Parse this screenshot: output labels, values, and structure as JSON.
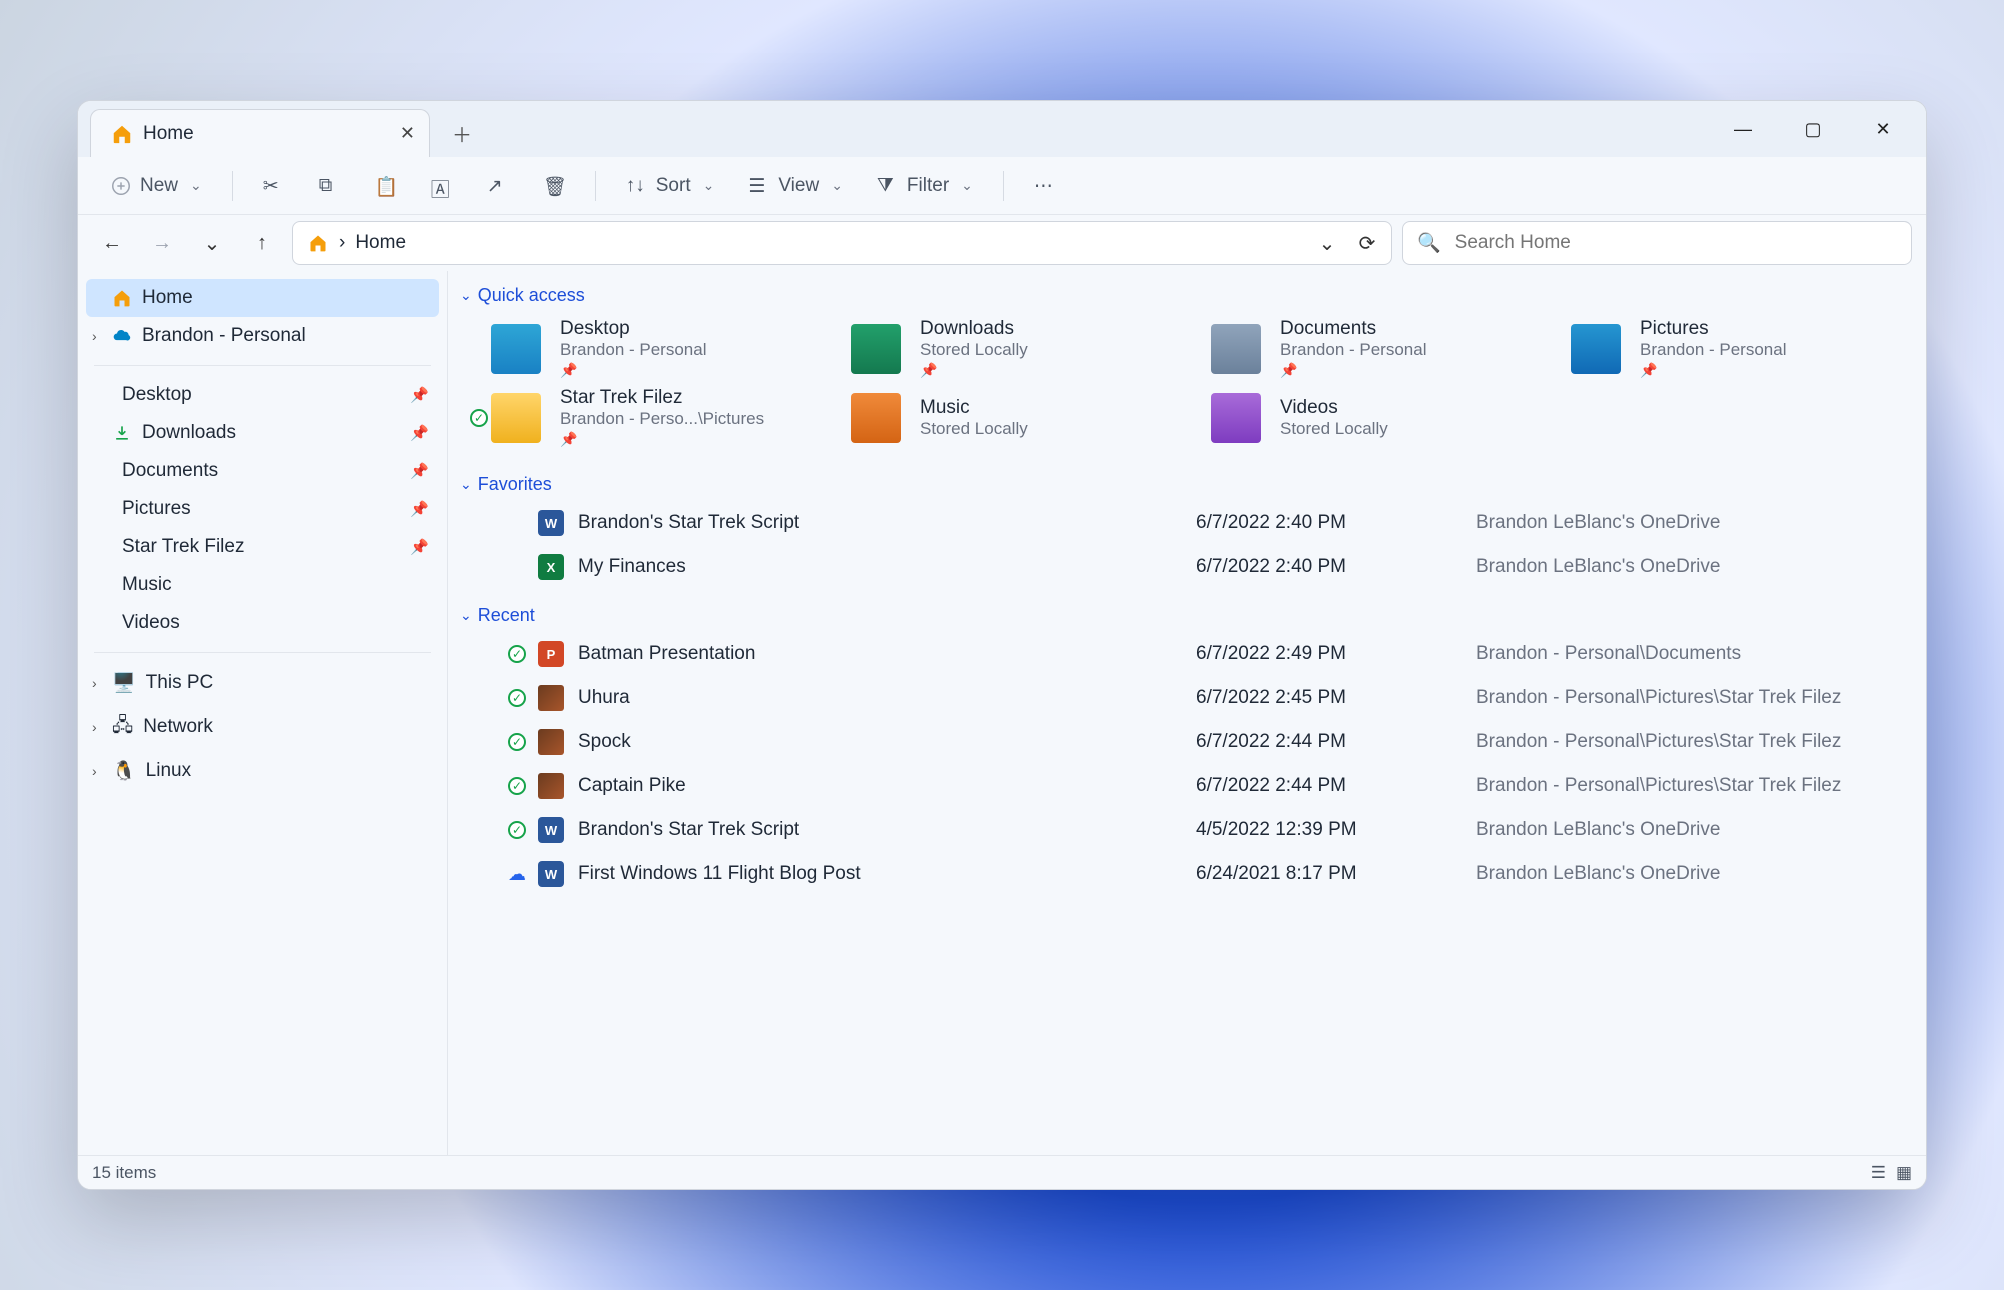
{
  "tab": {
    "title": "Home"
  },
  "toolbar": {
    "new": "New",
    "sort": "Sort",
    "view": "View",
    "filter": "Filter"
  },
  "address": {
    "path": "Home",
    "separator": "›"
  },
  "search": {
    "placeholder": "Search Home"
  },
  "sidebar": {
    "top": [
      {
        "label": "Home",
        "icon": "home",
        "active": true,
        "expand": false
      },
      {
        "label": "Brandon - Personal",
        "icon": "onedrive",
        "active": false,
        "expand": true
      }
    ],
    "pinned": [
      {
        "label": "Desktop",
        "icon": "desktop",
        "pinned": true
      },
      {
        "label": "Downloads",
        "icon": "download",
        "pinned": true
      },
      {
        "label": "Documents",
        "icon": "doc",
        "pinned": true
      },
      {
        "label": "Pictures",
        "icon": "pic",
        "pinned": true
      },
      {
        "label": "Star Trek Filez",
        "icon": "folder",
        "pinned": true
      },
      {
        "label": "Music",
        "icon": "music",
        "pinned": false
      },
      {
        "label": "Videos",
        "icon": "video",
        "pinned": false
      }
    ],
    "bottom": [
      {
        "label": "This PC",
        "expand": true
      },
      {
        "label": "Network",
        "expand": true
      },
      {
        "label": "Linux",
        "expand": true
      }
    ]
  },
  "sections": {
    "quick": {
      "title": "Quick access",
      "items": [
        {
          "title": "Desktop",
          "sub": "Brandon - Personal",
          "color": "f-blue",
          "badged": false,
          "pinned": true
        },
        {
          "title": "Downloads",
          "sub": "Stored Locally",
          "color": "f-green",
          "badged": false,
          "pinned": true
        },
        {
          "title": "Documents",
          "sub": "Brandon - Personal",
          "color": "f-grey",
          "badged": false,
          "pinned": true
        },
        {
          "title": "Pictures",
          "sub": "Brandon - Personal",
          "color": "f-teal",
          "badged": false,
          "pinned": true
        },
        {
          "title": "Star Trek Filez",
          "sub": "Brandon - Perso...\\Pictures",
          "color": "f-yellow",
          "badged": true,
          "pinned": true
        },
        {
          "title": "Music",
          "sub": "Stored Locally",
          "color": "f-orange",
          "badged": false,
          "pinned": false
        },
        {
          "title": "Videos",
          "sub": "Stored Locally",
          "color": "f-purple",
          "badged": false,
          "pinned": false
        }
      ]
    },
    "favorites": {
      "title": "Favorites",
      "rows": [
        {
          "status": "",
          "ftype": "word",
          "name": "Brandon's Star Trek Script",
          "date": "6/7/2022 2:40 PM",
          "loc": "Brandon LeBlanc's OneDrive"
        },
        {
          "status": "",
          "ftype": "excel",
          "name": "My Finances",
          "date": "6/7/2022 2:40 PM",
          "loc": "Brandon LeBlanc's OneDrive"
        }
      ]
    },
    "recent": {
      "title": "Recent",
      "rows": [
        {
          "status": "check",
          "ftype": "ppt",
          "name": "Batman Presentation",
          "date": "6/7/2022 2:49 PM",
          "loc": "Brandon - Personal\\Documents"
        },
        {
          "status": "check",
          "ftype": "thumb",
          "name": "Uhura",
          "date": "6/7/2022 2:45 PM",
          "loc": "Brandon - Personal\\Pictures\\Star Trek Filez"
        },
        {
          "status": "check",
          "ftype": "thumb",
          "name": "Spock",
          "date": "6/7/2022 2:44 PM",
          "loc": "Brandon - Personal\\Pictures\\Star Trek Filez"
        },
        {
          "status": "check",
          "ftype": "thumb",
          "name": "Captain Pike",
          "date": "6/7/2022 2:44 PM",
          "loc": "Brandon - Personal\\Pictures\\Star Trek Filez"
        },
        {
          "status": "check",
          "ftype": "word",
          "name": "Brandon's Star Trek Script",
          "date": "4/5/2022 12:39 PM",
          "loc": "Brandon LeBlanc's OneDrive"
        },
        {
          "status": "cloud",
          "ftype": "word",
          "name": "First Windows 11 Flight Blog Post",
          "date": "6/24/2021 8:17 PM",
          "loc": "Brandon LeBlanc's OneDrive"
        }
      ]
    }
  },
  "statusbar": {
    "text": "15 items"
  }
}
